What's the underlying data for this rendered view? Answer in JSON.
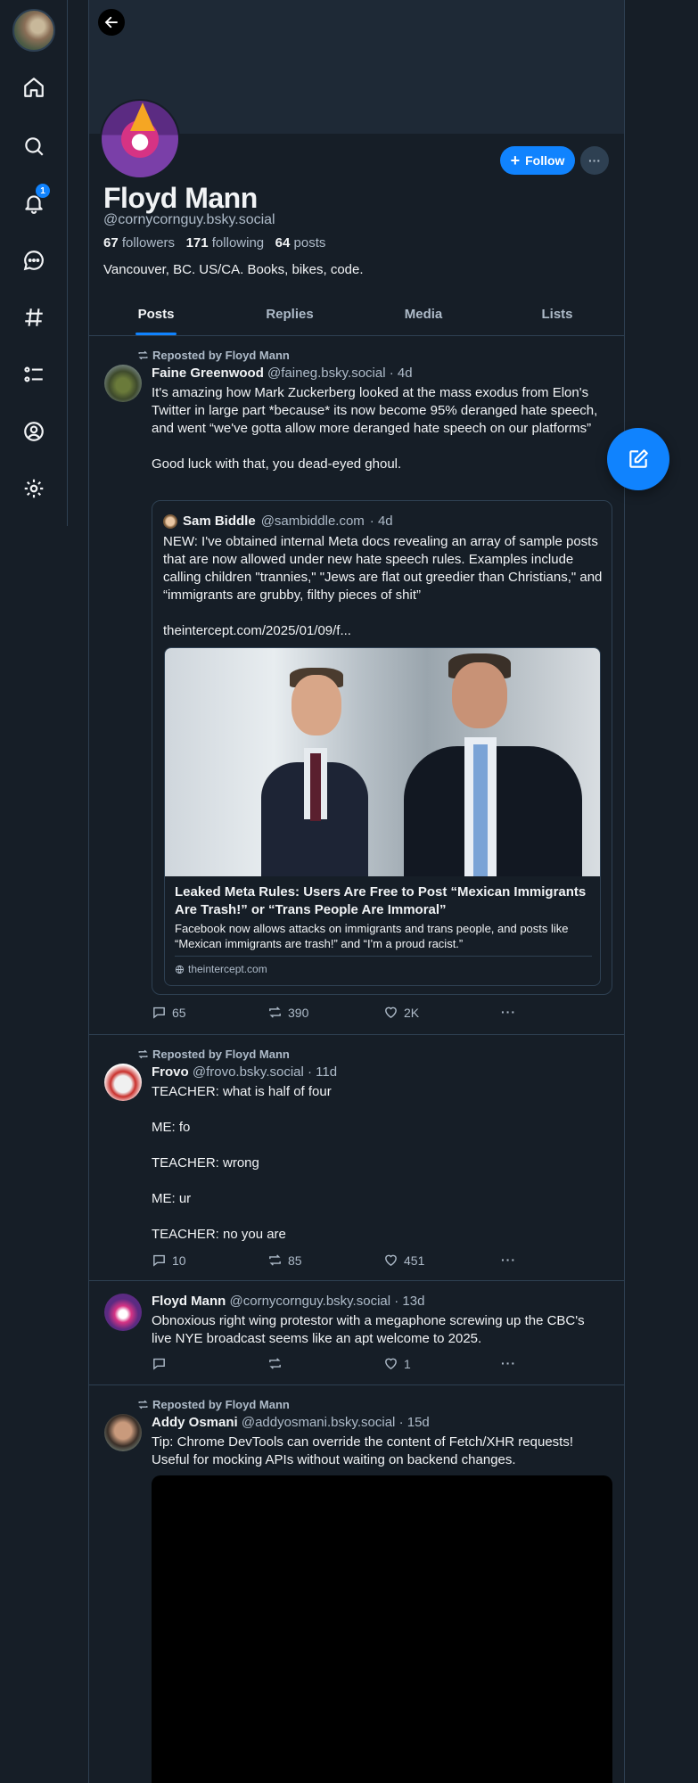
{
  "nav": {
    "notifications_count": "1",
    "icons": [
      "home-icon",
      "search-icon",
      "bell-icon",
      "chat-icon",
      "hashtag-icon",
      "list-icon",
      "profile-icon",
      "gear-icon"
    ]
  },
  "profile": {
    "display_name": "Floyd Mann",
    "handle": "@cornycornguy.bsky.social",
    "followers_count": "67",
    "followers_label": "followers",
    "following_count": "171",
    "following_label": "following",
    "posts_count": "64",
    "posts_label": "posts",
    "bio": "Vancouver, BC. US/CA. Books, bikes, code.",
    "follow_label": "Follow",
    "more_label": "···"
  },
  "tabs": [
    {
      "label": "Posts",
      "active": true
    },
    {
      "label": "Replies",
      "active": false
    },
    {
      "label": "Media",
      "active": false
    },
    {
      "label": "Lists",
      "active": false
    }
  ],
  "posts": [
    {
      "repost_label": "Reposted by Floyd Mann",
      "author": "Faine Greenwood",
      "handle": "@faineg.bsky.social",
      "time": "· 4d",
      "text": "It's amazing how Mark Zuckerberg looked at the mass exodus from Elon's Twitter in large part *because* its now become 95% deranged hate speech, and went “we've gotta allow more deranged hate speech on our platforms”\n\nGood luck with that, you dead-eyed ghoul.",
      "quote": {
        "author": "Sam Biddle",
        "handle": "@sambiddle.com",
        "time": "· 4d",
        "text": "NEW: I've obtained internal Meta docs revealing an array of sample posts that are now allowed under new hate speech rules. Examples include calling children \"trannies,\" \"Jews are flat out greedier than Christians,\" and “immigrants are grubby, filthy pieces of shit”\n\ntheintercept.com/2025/01/09/f...",
        "card_title": "Leaked Meta Rules: Users Are Free to Post “Mexican Immigrants Are Trash!” or “Trans People Are Immoral”",
        "card_desc": "Facebook now allows attacks on immigrants and trans people, and posts like “Mexican immigrants are trash!” and “I'm a proud racist.”",
        "card_domain": "theintercept.com"
      },
      "replies": "65",
      "reposts": "390",
      "likes": "2K"
    },
    {
      "repost_label": "Reposted by Floyd Mann",
      "author": "Frovo",
      "handle": "@frovo.bsky.social",
      "time": "· 11d",
      "text": "TEACHER: what is half of four\n\nME: fo\n\nTEACHER: wrong\n\nME: ur\n\nTEACHER: no you are",
      "replies": "10",
      "reposts": "85",
      "likes": "451"
    },
    {
      "author": "Floyd Mann",
      "handle": "@cornycornguy.bsky.social",
      "time": "· 13d",
      "text": "Obnoxious right wing protestor with a megaphone screwing up the CBC's live NYE broadcast seems like an apt welcome to 2025.",
      "replies": "",
      "reposts": "",
      "likes": "1"
    },
    {
      "repost_label": "Reposted by Floyd Mann",
      "author": "Addy Osmani",
      "handle": "@addyosmani.bsky.social",
      "time": "· 15d",
      "text": "Tip: Chrome DevTools can override the content of Fetch/XHR requests! Useful for mocking APIs without waiting on backend changes."
    }
  ],
  "colors": {
    "background": "#161e27",
    "accent": "#1083fe",
    "border": "#2e4052",
    "muted_text": "#aebbc9"
  }
}
